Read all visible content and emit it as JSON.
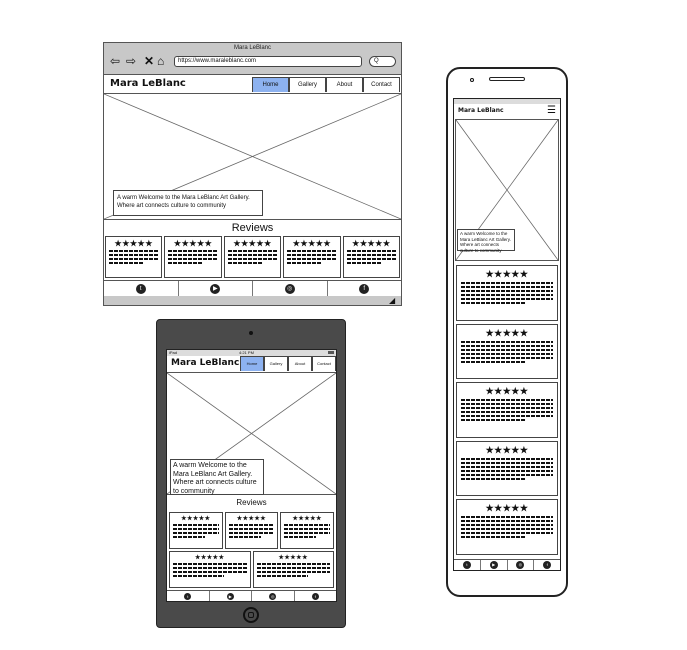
{
  "site": {
    "brand": "Mara LeBlanc",
    "nav": [
      {
        "label": "Home",
        "active": true
      },
      {
        "label": "Gallery",
        "active": false
      },
      {
        "label": "About",
        "active": false
      },
      {
        "label": "Contact",
        "active": false
      }
    ],
    "caption": "A warm Welcome to the Mara LeBlanc Art Gallery. Where art connects culture to community",
    "reviews_title": "Reviews",
    "stars": "★★★★★",
    "social": [
      "twitter-icon",
      "youtube-icon",
      "instagram-icon",
      "facebook-icon"
    ]
  },
  "desktop": {
    "window_title": "Mara LeBlanc",
    "url": "https://www.maraleblanc.com",
    "search_glyph": "Q",
    "review_count": 5
  },
  "tablet": {
    "status_left": "iPad",
    "status_center": "4:21 PM",
    "review_count": 5
  },
  "phone": {
    "menu_glyph": "☰",
    "review_count": 5
  },
  "colors": {
    "active_tab": "#8db2f0",
    "browser_chrome": "#c8c8c8",
    "tablet_body": "#4a4a4a"
  }
}
